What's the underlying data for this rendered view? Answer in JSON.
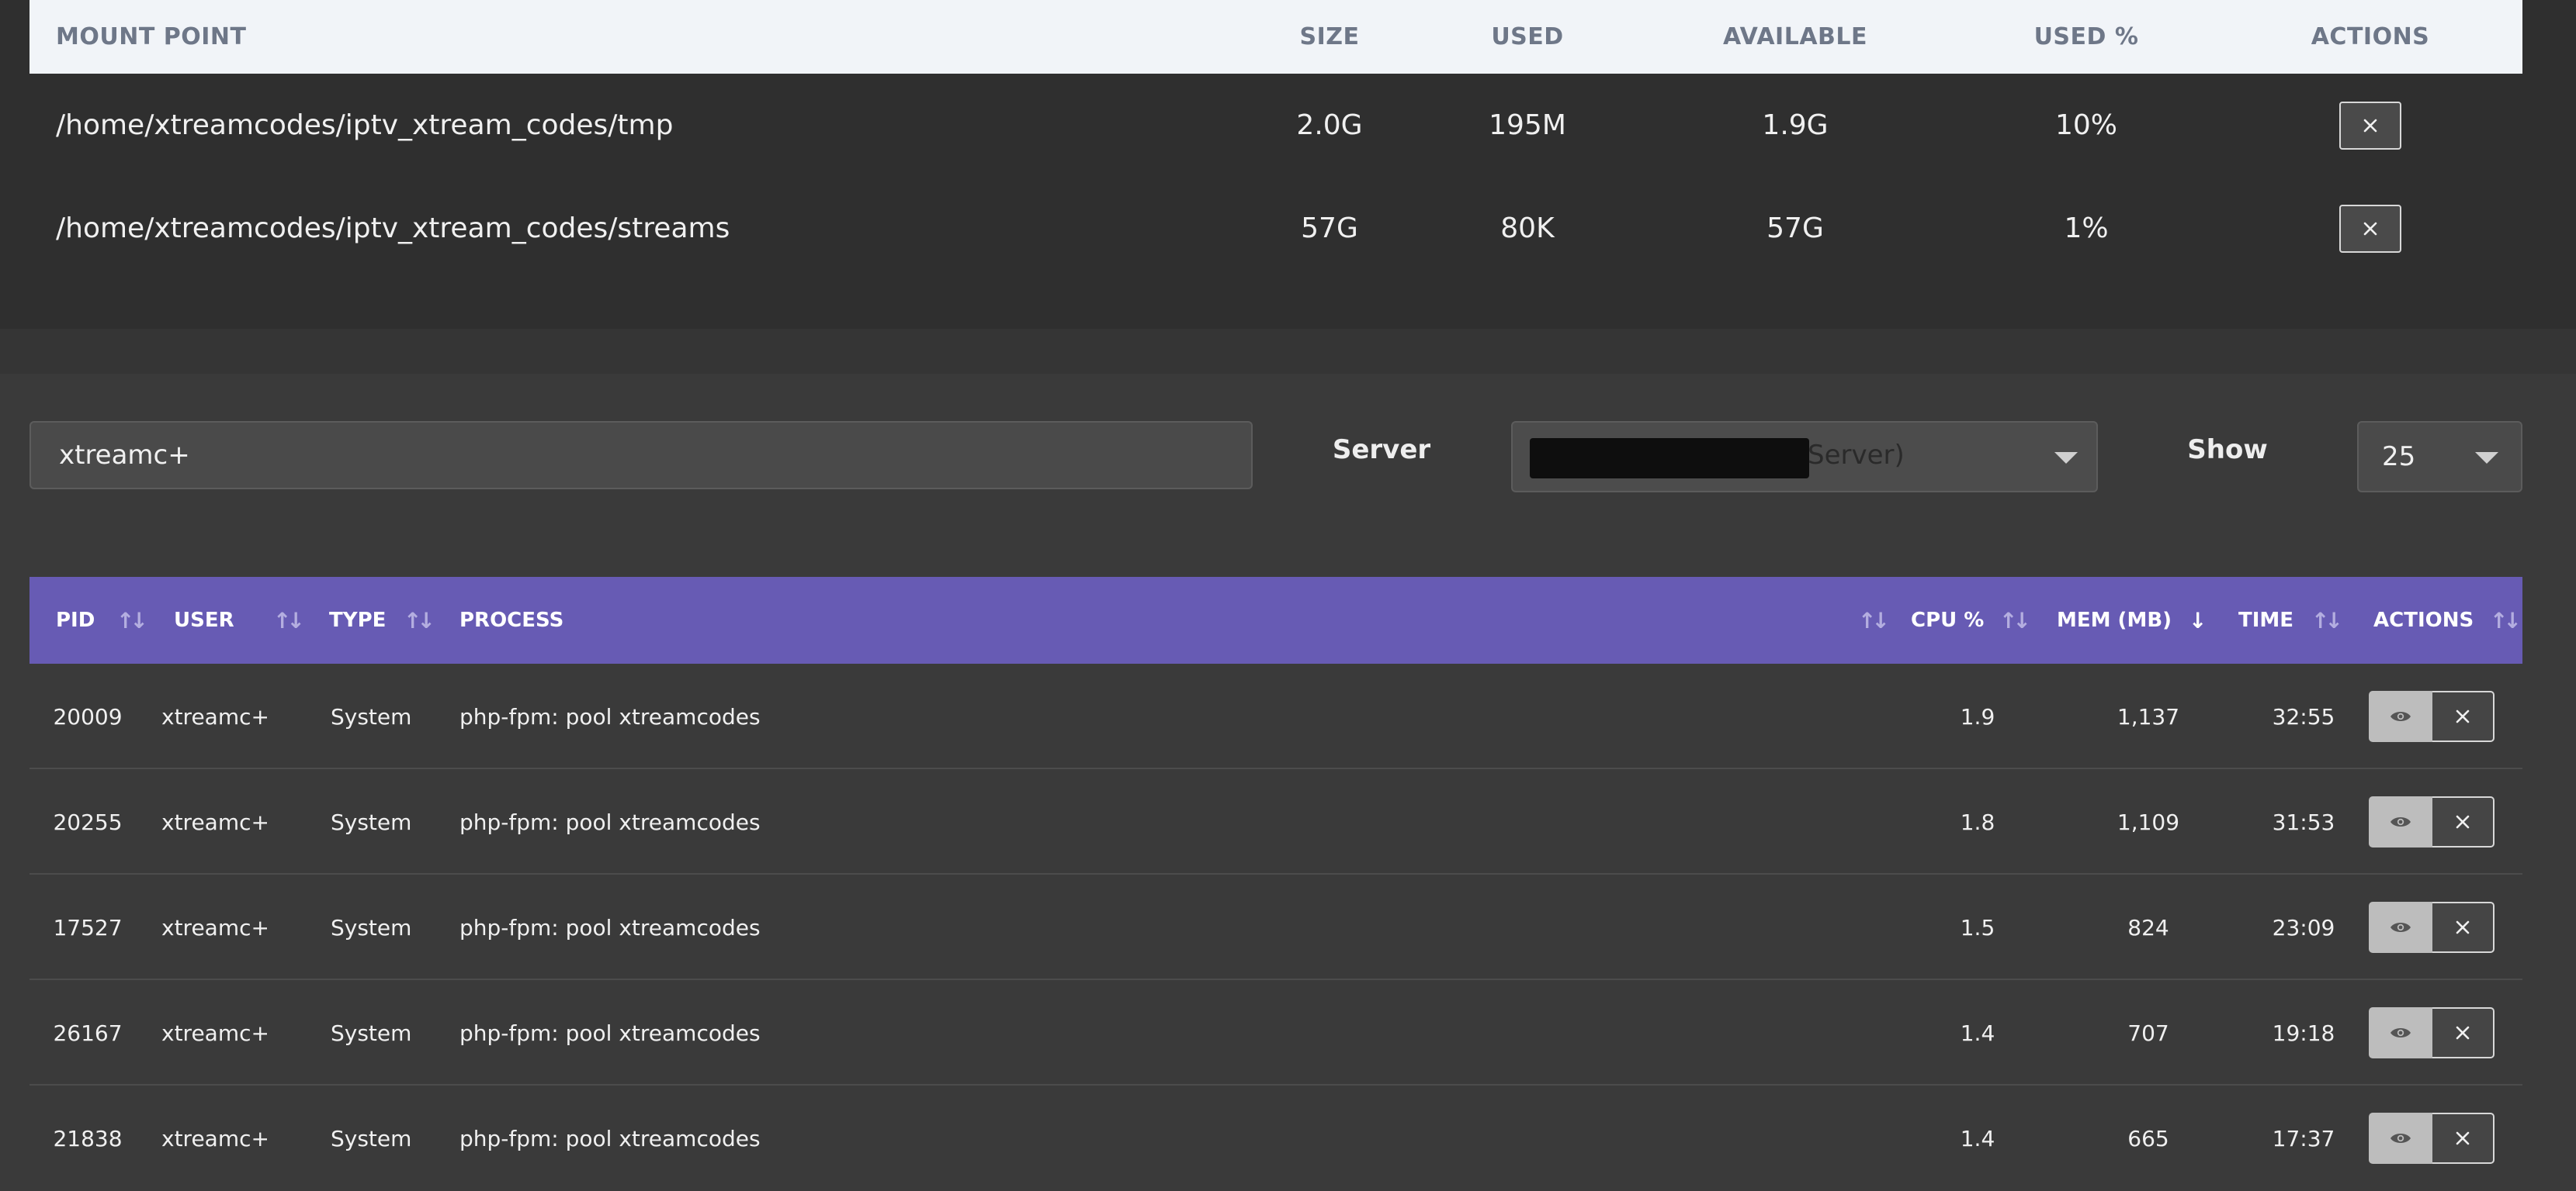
{
  "mounts": {
    "headers": {
      "mount_point": "MOUNT POINT",
      "size": "SIZE",
      "used": "USED",
      "available": "AVAILABLE",
      "used_pct": "USED %",
      "actions": "ACTIONS"
    },
    "rows": [
      {
        "mount_point": "/home/xtreamcodes/iptv_xtream_codes/tmp",
        "size": "2.0G",
        "used": "195M",
        "available": "1.9G",
        "used_pct": "10%"
      },
      {
        "mount_point": "/home/xtreamcodes/iptv_xtream_codes/streams",
        "size": "57G",
        "used": "80K",
        "available": "57G",
        "used_pct": "1%"
      }
    ]
  },
  "filters": {
    "search_value": "xtreamc+",
    "server_label": "Server",
    "server_value_visible": "Server)",
    "show_label": "Show",
    "show_value": "25"
  },
  "processes": {
    "headers": {
      "pid": "PID",
      "user": "USER",
      "type": "TYPE",
      "process": "PROCESS",
      "cpu": "CPU %",
      "mem": "MEM (MB)",
      "time": "TIME",
      "actions": "ACTIONS"
    },
    "sort_icon": "↑↓",
    "active_sort_icon": "↓",
    "rows": [
      {
        "pid": "20009",
        "user": "xtreamc+",
        "type": "System",
        "process": "php-fpm: pool xtreamcodes",
        "cpu": "1.9",
        "mem": "1,137",
        "time": "32:55"
      },
      {
        "pid": "20255",
        "user": "xtreamc+",
        "type": "System",
        "process": "php-fpm: pool xtreamcodes",
        "cpu": "1.8",
        "mem": "1,109",
        "time": "31:53"
      },
      {
        "pid": "17527",
        "user": "xtreamc+",
        "type": "System",
        "process": "php-fpm: pool xtreamcodes",
        "cpu": "1.5",
        "mem": "824",
        "time": "23:09"
      },
      {
        "pid": "26167",
        "user": "xtreamc+",
        "type": "System",
        "process": "php-fpm: pool xtreamcodes",
        "cpu": "1.4",
        "mem": "707",
        "time": "19:18"
      },
      {
        "pid": "21838",
        "user": "xtreamc+",
        "type": "System",
        "process": "php-fpm: pool xtreamcodes",
        "cpu": "1.4",
        "mem": "665",
        "time": "17:37"
      }
    ]
  },
  "colors": {
    "page_bg": "#3a3a3a",
    "card_bg": "#2f2f2f",
    "mount_header_bg": "#f1f4f8",
    "process_header_bg": "#675bb4",
    "view_button_bg": "#bdbdbd"
  },
  "icons": {
    "mount_action": "close-icon",
    "process_view": "eye-icon",
    "process_kill": "close-icon",
    "select_caret": "caret-down-icon"
  }
}
